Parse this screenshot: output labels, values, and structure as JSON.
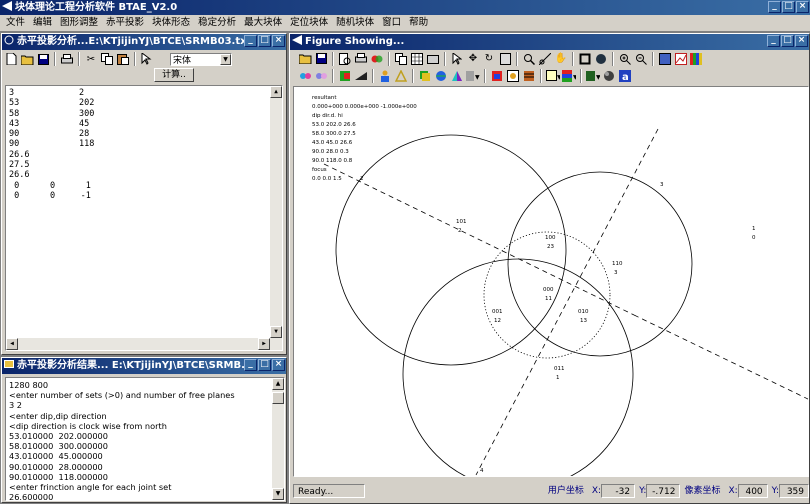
{
  "app": {
    "title": "块体理论工程分析软件 BTAE_V2.0"
  },
  "menu": [
    "文件",
    "编辑",
    "图形调整",
    "赤平投影",
    "块体形态",
    "稳定分析",
    "最大块体",
    "定位块体",
    "随机块体",
    "窗口",
    "帮助"
  ],
  "input_window": {
    "title": "赤平投影分析...E:\\KTjijinYJ\\BTCE\\SRMB03.txt",
    "font_select": "宋体",
    "compute_button": "计算..",
    "lines": [
      [
        "3",
        "2"
      ],
      [
        "53",
        "202"
      ],
      [
        "58",
        "300"
      ],
      [
        "43",
        "45"
      ],
      [
        "90",
        "28"
      ],
      [
        "90",
        "118"
      ],
      [
        "26.6",
        ""
      ],
      [
        "27.5",
        ""
      ],
      [
        "26.6",
        ""
      ],
      [
        " 0      0      1",
        ""
      ],
      [
        " 0      0     -1",
        ""
      ]
    ]
  },
  "result_window": {
    "title": "赤平投影分析结果... E:\\KTjijinYJ\\BTCE\\SRMB...",
    "lines": [
      "1280 800",
      "<enter number of sets (>0) and number of free planes",
      "3 2",
      "<enter dip,dip direction",
      "<dip direction is clock wise from north",
      "53.010000  202.000000",
      "58.010000  300.000000",
      "43.010000  45.000000",
      "90.010000  28.000000",
      "90.010000  118.000000",
      "<enter frinction angle for each joint set",
      "26.600000"
    ]
  },
  "figure_window": {
    "title": "Figure Showing...",
    "legend_lines": [
      "resultant",
      "0.000+000 0.000e+000 -1.000e+000",
      "dip   dir.d.   hi",
      "53.0 202.0 26.6",
      "58.0 300.0 27.5",
      "43.0 45.0 26.6",
      "90.0 28.0 0.3",
      "90.0 118.0 0.8",
      "focus",
      "0.0  0.0  1.5"
    ],
    "labels": {
      "l2": "2",
      "l3": "3",
      "l101": "101",
      "l2b": "2",
      "l100": "100",
      "l23": "23",
      "l110": "110",
      "l3b": "3",
      "l000": "000",
      "l11": "11",
      "l001": "001",
      "l12": "12",
      "l010": "010",
      "l13": "13",
      "l011": "011",
      "l1": "1",
      "l4": "4",
      "r1": "1",
      "r2": "0"
    }
  },
  "status": {
    "ready": "Ready...",
    "user_coord_label": "用户坐标",
    "ux_label": "X:",
    "ux": "-32",
    "uy_label": "Y:",
    "uy": "-.712",
    "pixel_coord_label": "像素坐标",
    "px_label": "X:",
    "px": "400",
    "py_label": "Y:",
    "py": "359"
  }
}
